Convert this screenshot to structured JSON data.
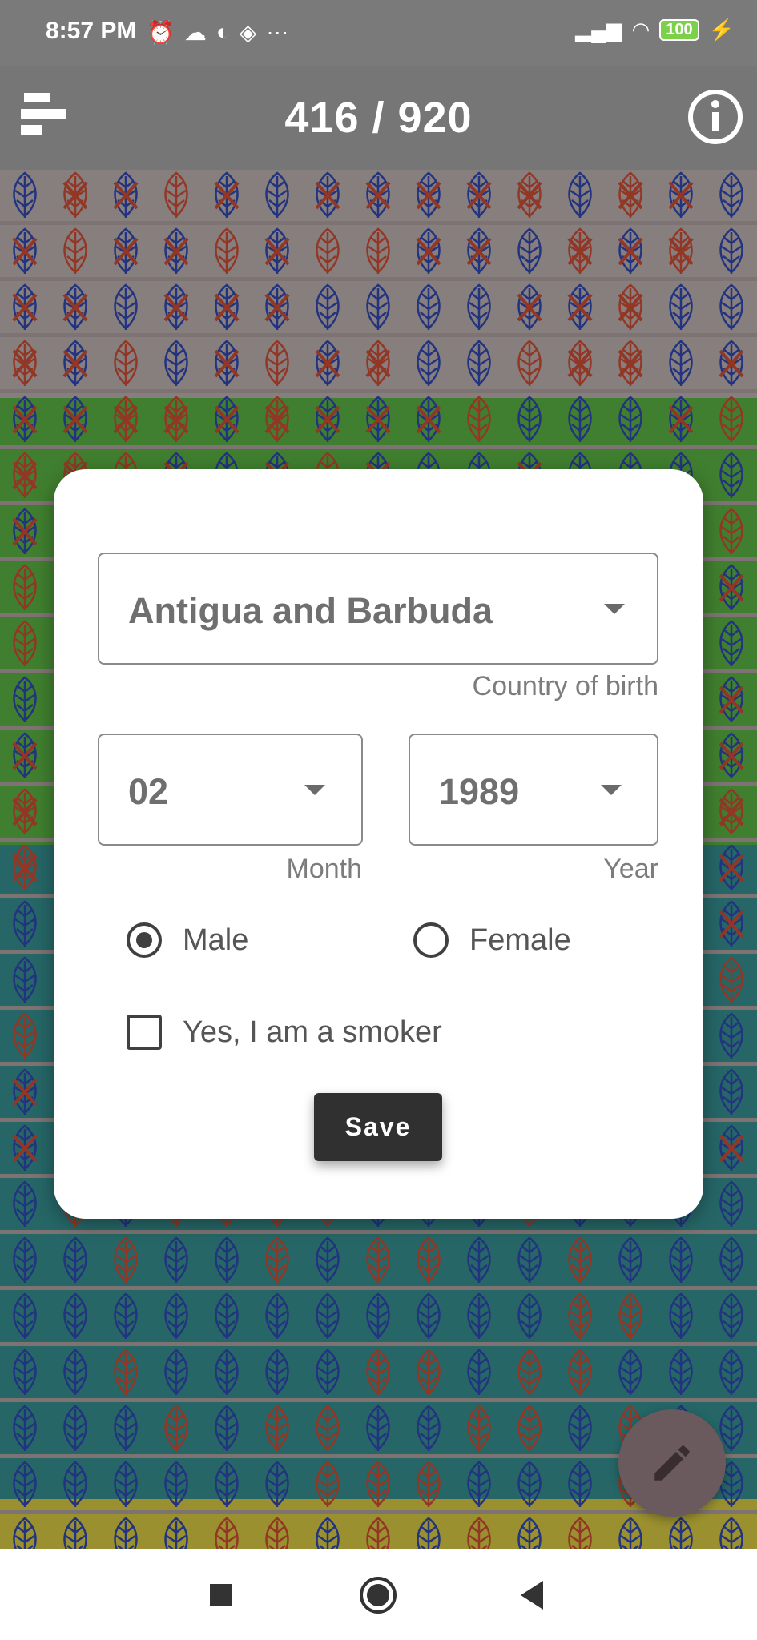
{
  "status_bar": {
    "time": "8:57 PM",
    "left_icons": [
      "alarm-icon",
      "cloud-icon",
      "app-icon",
      "layers-icon",
      "more-icon"
    ],
    "battery": "100"
  },
  "app_bar": {
    "counter": "416 / 920",
    "menu_icon": "menu-icon",
    "info_icon": "info-icon"
  },
  "dialog": {
    "country": {
      "value": "Antigua and Barbuda",
      "label": "Country of birth"
    },
    "month": {
      "value": "02",
      "label": "Month"
    },
    "year": {
      "value": "1989",
      "label": "Year"
    },
    "gender": {
      "options": [
        {
          "label": "Male",
          "checked": true
        },
        {
          "label": "Female",
          "checked": false
        }
      ]
    },
    "smoker": {
      "label": "Yes, I am a smoker",
      "checked": false
    },
    "save_label": "Save"
  },
  "colors": {
    "band_gray": "#a59a9a",
    "band_green": "#4f9b3a",
    "band_teal": "#2f7d7e",
    "band_yellow": "#bcb03a",
    "leaf_blue": "#2a3f9b",
    "leaf_red": "#b2442e"
  },
  "fab_icon": "pencil-icon",
  "nav": {
    "icons": [
      "square-icon",
      "circle-icon",
      "back-triangle-icon"
    ]
  }
}
